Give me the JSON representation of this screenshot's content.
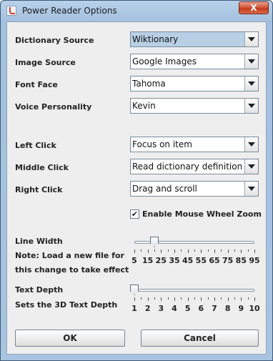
{
  "window": {
    "title": "Power Reader Options",
    "close_label": "X"
  },
  "labels": {
    "dictionary_source": "Dictionary Source",
    "image_source": "Image Source",
    "font_face": "Font Face",
    "voice_personality": "Voice Personality",
    "left_click": "Left Click",
    "middle_click": "Middle Click",
    "right_click": "Right Click",
    "line_width": "Line Width",
    "line_width_note_1": "Note: Load a new file for",
    "line_width_note_2": "this change to take effect",
    "text_depth": "Text Depth",
    "text_depth_note": "Sets the 3D Text Depth"
  },
  "selects": {
    "dictionary_source": "Wiktionary",
    "image_source": "Google Images",
    "font_face": "Tahoma",
    "voice_personality": "Kevin",
    "left_click": "Focus on item",
    "middle_click": "Read dictionary definition",
    "right_click": "Drag and scroll"
  },
  "mouse_wheel_zoom": {
    "label": "Enable Mouse Wheel Zoom",
    "checked": true,
    "check_glyph": "✔"
  },
  "line_width_slider": {
    "ticks": [
      "5",
      "15",
      "25",
      "35",
      "45",
      "55",
      "65",
      "75",
      "85",
      "95"
    ],
    "value": 20,
    "min": 5,
    "max": 95
  },
  "text_depth_slider": {
    "ticks": [
      "1",
      "2",
      "3",
      "4",
      "5",
      "6",
      "7",
      "8",
      "9",
      "10"
    ],
    "value": 1,
    "min": 1,
    "max": 10
  },
  "buttons": {
    "ok": "OK",
    "cancel": "Cancel"
  },
  "icons": {
    "app": "java-app-icon",
    "close": "close-icon",
    "dropdown": "chevron-down-icon"
  }
}
